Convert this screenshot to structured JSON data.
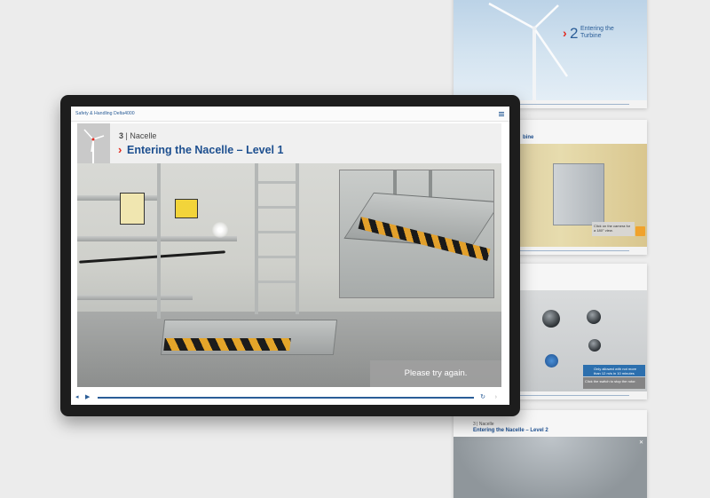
{
  "colors": {
    "brand_blue": "#1d4f8f",
    "accent_red": "#e22a1f",
    "feedback_gray": "#a0a0a0"
  },
  "tablet": {
    "app_title": "Safety & Handling Delta4000",
    "section_number": "3",
    "section_name": "Nacelle",
    "slide_title": "Entering the Nacelle – Level 1",
    "feedback": "Please try again.",
    "icons": [
      "menu-icon",
      "volume-icon",
      "play-icon",
      "replay-icon",
      "next-icon"
    ]
  },
  "thumbnails": {
    "t1": {
      "number": "2",
      "title": "Entering the Turbine"
    },
    "t2": {
      "title": "bine",
      "info": "Click on the camera for a 180° view."
    },
    "t3": {
      "note": "Only allowed with not more than 12 m/s in 10 minutes",
      "note2": "Click the switch to stop the rotor."
    },
    "t4": {
      "section": "3 | Nacelle",
      "title": "Entering the Nacelle – Level 2",
      "close_icon": "close-icon"
    }
  }
}
